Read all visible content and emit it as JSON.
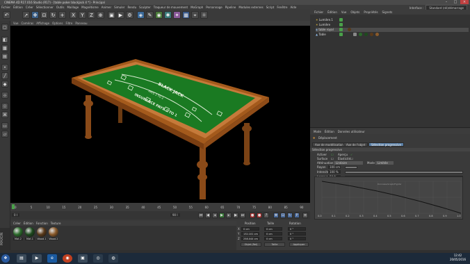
{
  "window": {
    "title": "CINEMA 4D R17.016 Studio (R17) - [table poker blackjack 4 *] - Principal"
  },
  "menu": {
    "items": [
      "Fichier",
      "Édition",
      "Créer",
      "Sélectionner",
      "Outils",
      "Maillage",
      "Magnétisme",
      "Animer",
      "Simuler",
      "Rendu",
      "Sculpter",
      "Traqueur de mouvement",
      "MoGraph",
      "Personnage",
      "Pipeline",
      "Modules externes",
      "Script",
      "Fenêtre",
      "Aide"
    ],
    "layout_label": "Interface :",
    "layout_value": "Standard (dé)démarrage"
  },
  "viewport": {
    "menu": [
      "Vue",
      "Caméras",
      "Affichage",
      "Options",
      "Filtre",
      "Panneau"
    ]
  },
  "timeline": {
    "ticks": [
      "0",
      "5",
      "10",
      "15",
      "20",
      "25",
      "30",
      "35",
      "40",
      "45",
      "50",
      "55",
      "60",
      "65",
      "70",
      "75",
      "80",
      "85",
      "90"
    ],
    "start_frame": "0 I",
    "end_frame": "90 I",
    "current": "0 I"
  },
  "materials": {
    "menu": [
      "Créer",
      "Édition",
      "Fonction",
      "Texture"
    ],
    "items": [
      {
        "name": "Mat.2",
        "color": "#2a6a2a"
      },
      {
        "name": "Mat.1",
        "color": "#1e4a1e"
      },
      {
        "name": "Wood.1",
        "color": "#5a3a1a"
      },
      {
        "name": "Wood.2",
        "color": "#8a5a2a"
      }
    ]
  },
  "branding": {
    "text": "MAXON"
  },
  "coords": {
    "headers": [
      "Position",
      "Taille",
      "Rotation"
    ],
    "axes": [
      "X",
      "Y",
      "Z"
    ],
    "position": [
      "0 cm",
      "132.101 cm",
      "258.044 cm"
    ],
    "size": [
      "0 cm",
      "0 cm",
      "0 cm"
    ],
    "rotation": [
      "0 °",
      "0 °",
      "0 °"
    ],
    "mode_select": "Objet (Rel)",
    "size_select": "Taille",
    "apply_label": "Appliquer"
  },
  "objects": {
    "menu": [
      "Fichier",
      "Édition",
      "Vue",
      "Objets",
      "Propriétés",
      "Signets"
    ],
    "items": [
      {
        "name": "Lumière.1"
      },
      {
        "name": "Lumière"
      },
      {
        "name": "table royal"
      },
      {
        "name": "Table"
      }
    ]
  },
  "attributes": {
    "menu": [
      "Mode",
      "Édition",
      "Données utilisateur"
    ],
    "title": "Déplacement",
    "tabs": [
      "Axe de modélisation",
      "Axe de l'objet",
      "Sélection progressive"
    ],
    "section": "Sélection progressive",
    "fields": [
      {
        "label": "Activer",
        "extra": "Aperçu"
      },
      {
        "label": "Surface",
        "extra": "Élasticité"
      },
      {
        "label": "Atténuation",
        "value": "Linéaire",
        "extra": "Mode",
        "extra_value": "Limitée"
      },
      {
        "label": "Rayon",
        "value": "100 cm"
      },
      {
        "label": "Intensité",
        "value": "100 %"
      },
      {
        "label": "Largeur",
        "value": "50 %"
      }
    ],
    "graph_ticks": [
      "0.0",
      "0.1",
      "0.2",
      "0.3",
      "0.4",
      "0.5",
      "0.6",
      "0.7",
      "0.8",
      "0.9",
      "1.0"
    ],
    "graph_caption": "Données/Graph/Fig/Ver"
  },
  "taskbar": {
    "time": "12:42",
    "date": "20/05/2016"
  }
}
